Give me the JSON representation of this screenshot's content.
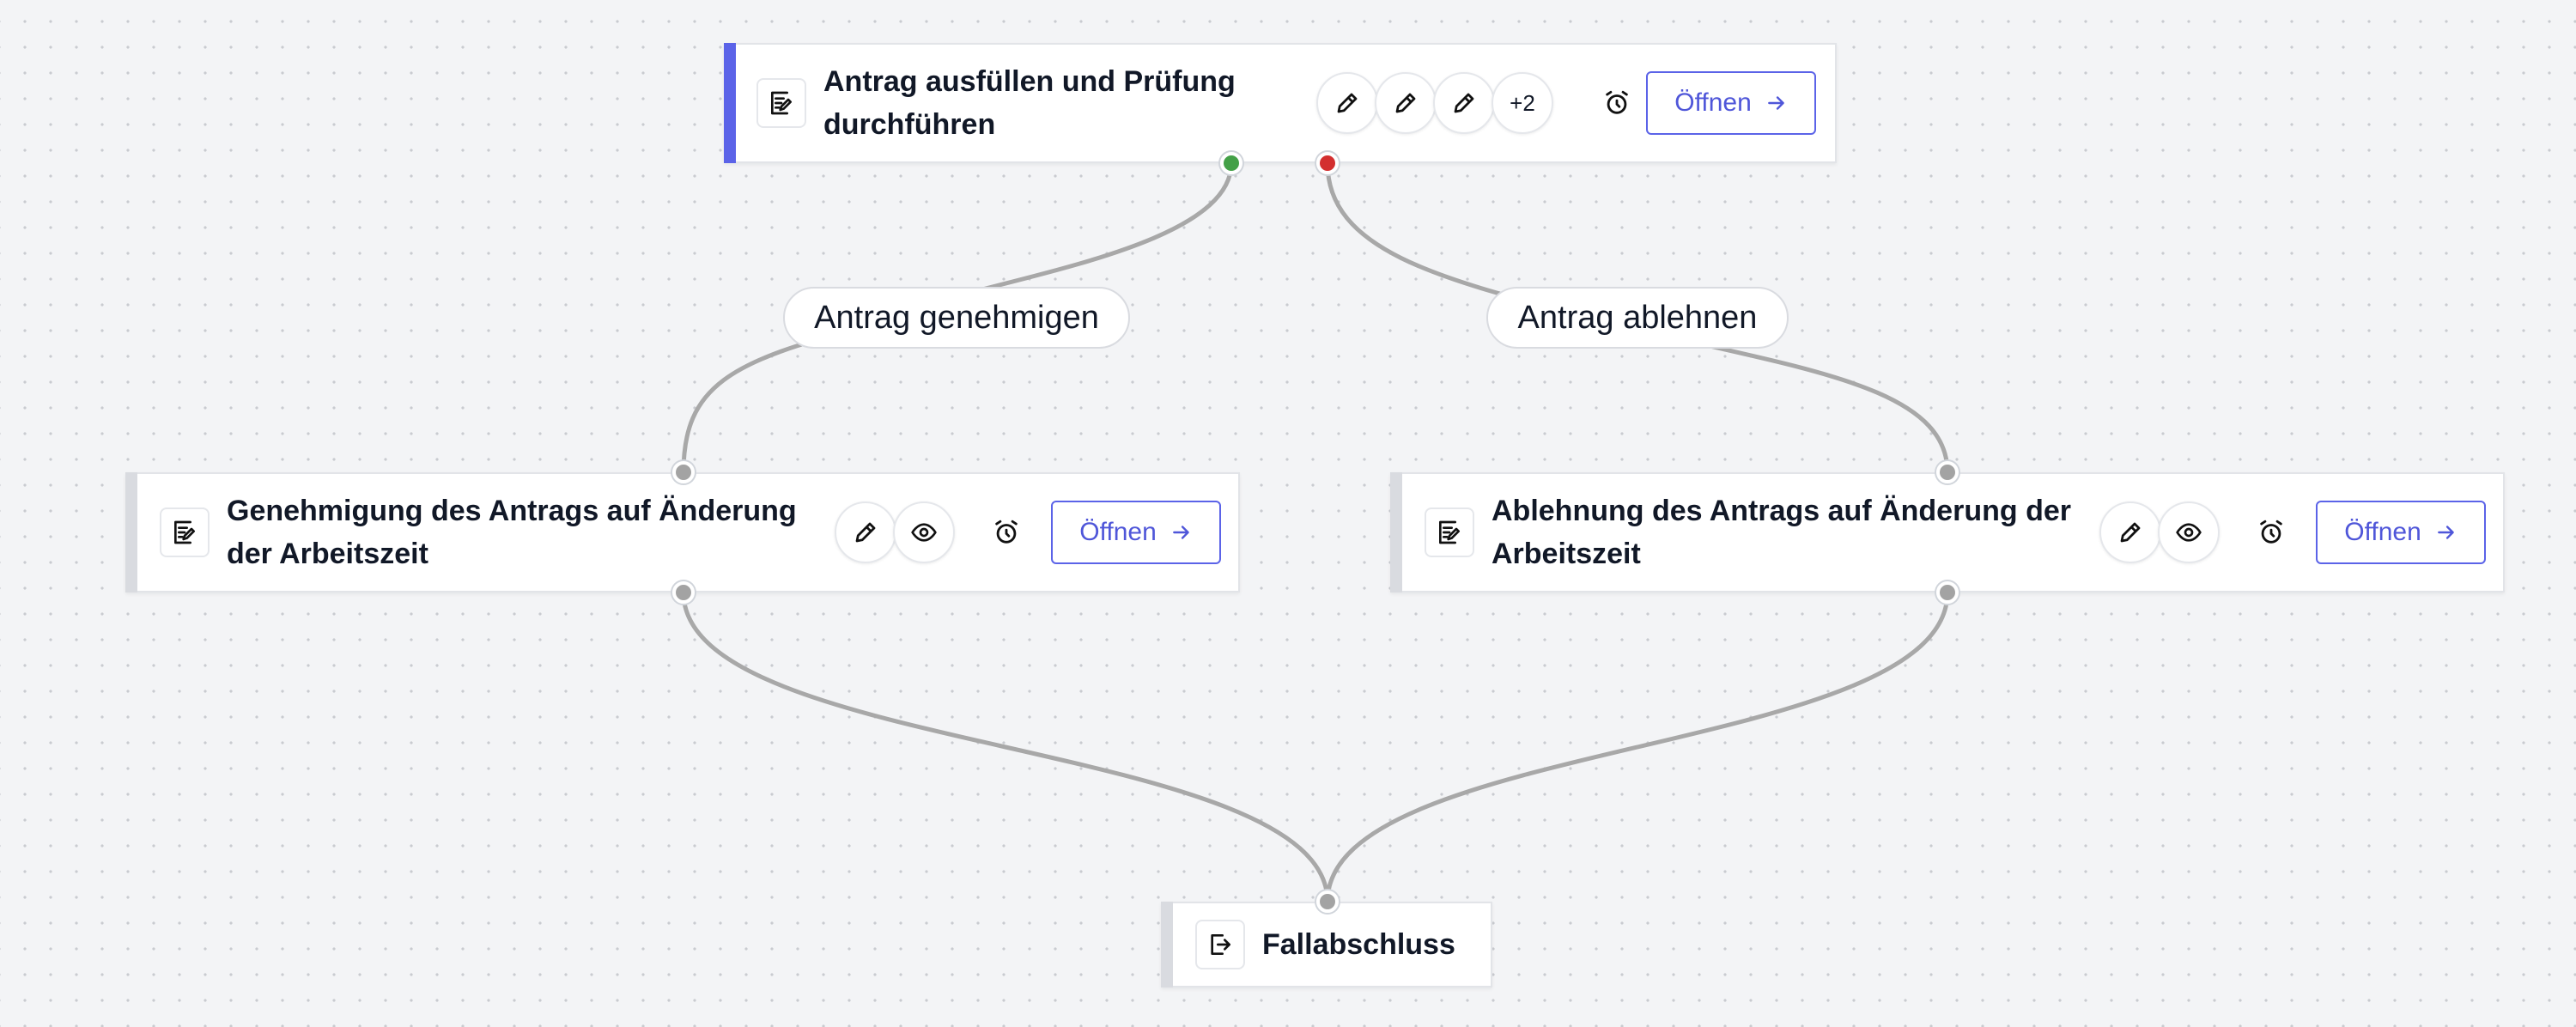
{
  "nodes": {
    "fill_and_review": {
      "title_line1": "Antrag ausfüllen und Prüfung",
      "title_line2": "durchführen",
      "icon": "form-edit-icon",
      "assignees": [
        "pencil-icon",
        "pencil-icon",
        "pencil-icon"
      ],
      "more_assignees": "+2",
      "timer_icon": "alarm-clock-icon",
      "open_label": "Öffnen",
      "accent": "#5b63e8"
    },
    "approval": {
      "title_line1": "Genehmigung des Antrags auf Änderung",
      "title_line2": "der Arbeitszeit",
      "icon": "form-edit-icon",
      "assignees": [
        "pencil-icon",
        "eye-icon"
      ],
      "timer_icon": "alarm-clock-icon",
      "open_label": "Öffnen"
    },
    "rejection": {
      "title_line1": "Ablehnung des Antrags auf Änderung der",
      "title_line2": "Arbeitszeit",
      "icon": "form-edit-icon",
      "assignees": [
        "pencil-icon",
        "eye-icon"
      ],
      "timer_icon": "alarm-clock-icon",
      "open_label": "Öffnen"
    },
    "case_close": {
      "title": "Fallabschluss",
      "icon": "exit-icon"
    }
  },
  "edges": {
    "approve_label": "Antrag genehmigen",
    "reject_label": "Antrag ablehnen"
  },
  "colors": {
    "accent": "#5b63e8",
    "handle_success": "#43a047",
    "handle_failure": "#d32f2f",
    "handle_default": "#a3a3a3",
    "edge": "#a8a8a8"
  }
}
